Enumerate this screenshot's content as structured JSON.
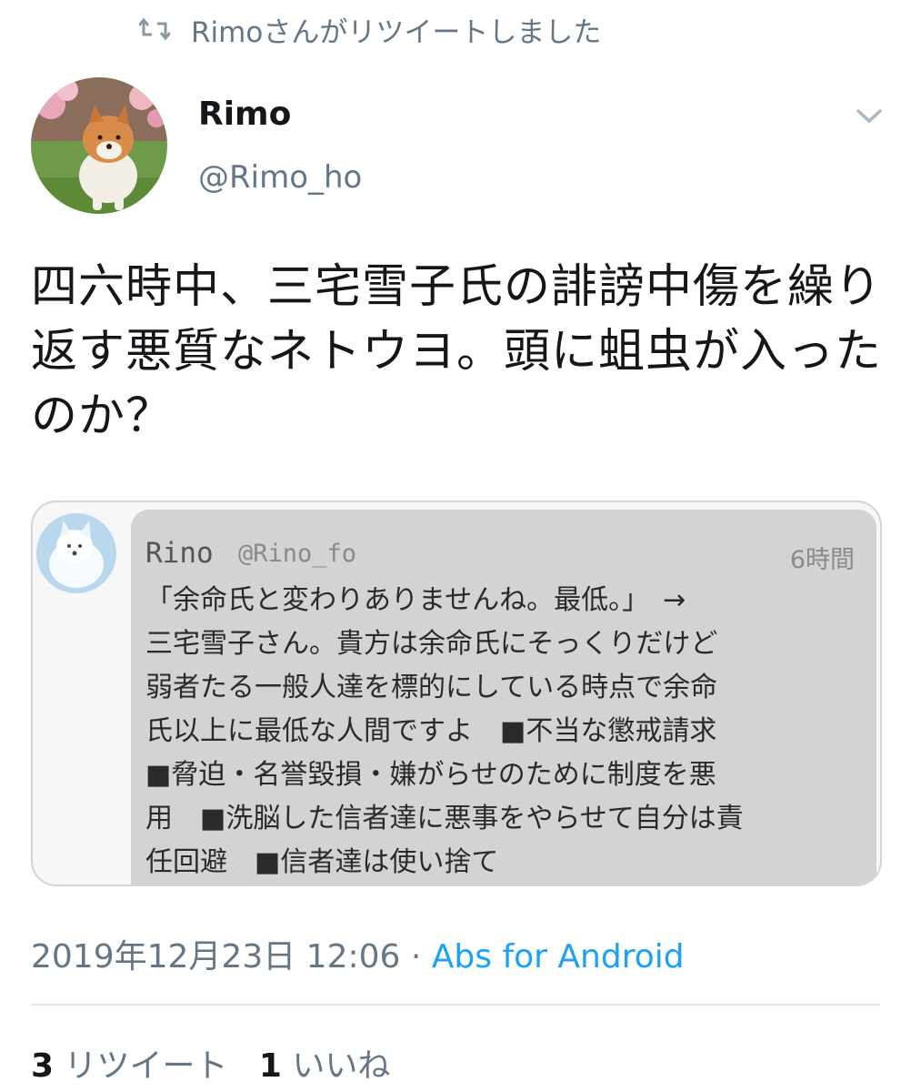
{
  "retweet_banner": {
    "icon": "retweet-icon",
    "text": "Rimoさんがリツイートしました"
  },
  "tweet": {
    "author_name": "Rimo",
    "author_handle": "@Rimo_ho",
    "text": "四六時中、三宅雪子氏の誹謗中傷を繰り返す悪質なネトウヨ。頭に蛆虫が入ったのか？",
    "quote": {
      "name": "Rino",
      "handle": "@Rino_fo",
      "time": "6時間",
      "body": "「余命氏と変わりありませんね。最低。」　→\n三宅雪子さん。貴方は余命氏にそっくりだけど\n弱者たる一般人達を標的にしている時点で余命\n氏以上に最低な人間ですよ　■不当な懲戒請求\n■脅迫・名誉毀損・嫌がらせのために制度を悪\n用　■洗脳した信者達に悪事をやらせて自分は責\n任回避　■信者達は使い捨て"
    },
    "timestamp": "2019年12月23日 12:06",
    "separator": "·",
    "via": "Abs for Android",
    "retweet_count": "3",
    "retweet_label": "リツイート",
    "like_count": "1",
    "like_label": "いいね"
  },
  "colors": {
    "accent": "#1da1f2",
    "secondary_text": "#657786",
    "primary_text": "#14171a",
    "divider": "#e1e8ed"
  }
}
